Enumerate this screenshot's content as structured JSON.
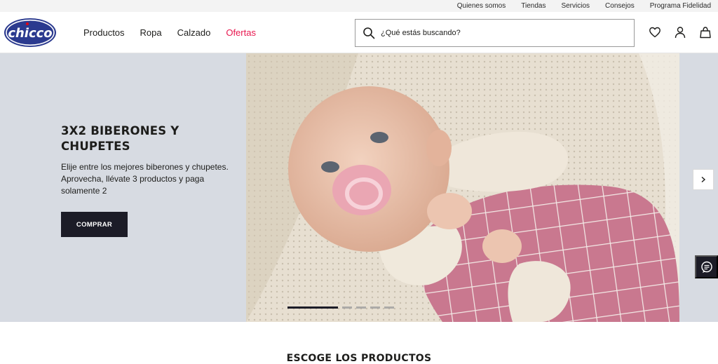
{
  "topbar": {
    "links": [
      "Quienes somos",
      "Tiendas",
      "Servicios",
      "Consejos",
      "Programa Fidelidad"
    ]
  },
  "header": {
    "logo_text": "chicco",
    "nav": [
      {
        "label": "Productos"
      },
      {
        "label": "Ropa"
      },
      {
        "label": "Calzado"
      },
      {
        "label": "Ofertas"
      }
    ],
    "search_placeholder": "¿Qué estás buscando?",
    "icons": [
      "heart-icon",
      "user-icon",
      "bag-icon"
    ]
  },
  "hero": {
    "title": "3X2 BIBERONES Y CHUPETES",
    "description": "Elije entre los mejores biberones y chupetes. Aprovecha, llévate 3 productos y paga solamente 2",
    "cta_label": "COMPRAR",
    "slides": 5,
    "active_slide": 1
  },
  "section": {
    "title": "ESCOGE LOS PRODUCTOS"
  },
  "colors": {
    "brand_blue": "#2b3a8f",
    "brand_red": "#e30613",
    "sale": "#e8174f",
    "dark": "#1c1c27",
    "hero_bg": "#d7dbe2"
  }
}
